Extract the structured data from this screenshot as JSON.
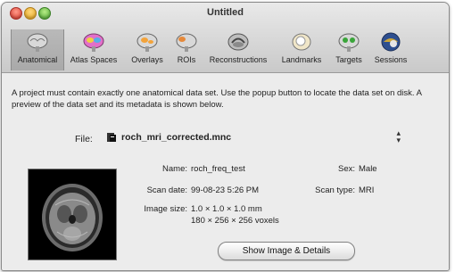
{
  "window": {
    "title": "Untitled"
  },
  "toolbar": {
    "items": [
      {
        "label": "Anatomical",
        "icon": "brain-icon",
        "selected": true
      },
      {
        "label": "Atlas Spaces",
        "icon": "colored-brain-icon",
        "selected": false
      },
      {
        "label": "Overlays",
        "icon": "brain-overlay-icon",
        "selected": false
      },
      {
        "label": "ROIs",
        "icon": "roi-brain-icon",
        "selected": false
      },
      {
        "label": "Reconstructions",
        "icon": "reconstruction-icon",
        "selected": false
      },
      {
        "label": "Landmarks",
        "icon": "landmark-icon",
        "selected": false
      },
      {
        "label": "Targets",
        "icon": "target-icon",
        "selected": false
      },
      {
        "label": "Sessions",
        "icon": "session-icon",
        "selected": false
      }
    ]
  },
  "content": {
    "description": "A project must contain exactly one anatomical data set. Use the popup button to locate the data set on disk. A preview of the data set and its metadata is shown below.",
    "file": {
      "label": "File:",
      "value": "roch_mri_corrected.mnc"
    },
    "metadata": {
      "name_label": "Name:",
      "name_value": "roch_freq_test",
      "sex_label": "Sex:",
      "sex_value": "Male",
      "scan_date_label": "Scan date:",
      "scan_date_value": "99-08-23 5:26 PM",
      "scan_type_label": "Scan type:",
      "scan_type_value": "MRI",
      "image_size_label": "Image size:",
      "image_size_value": "1.0 × 1.0 × 1.0 mm",
      "voxels_value": "180 × 256 × 256 voxels"
    },
    "show_button": "Show Image & Details"
  },
  "colors": {
    "toolbar_selected": "#ababab",
    "window_bg": "#ececec"
  }
}
